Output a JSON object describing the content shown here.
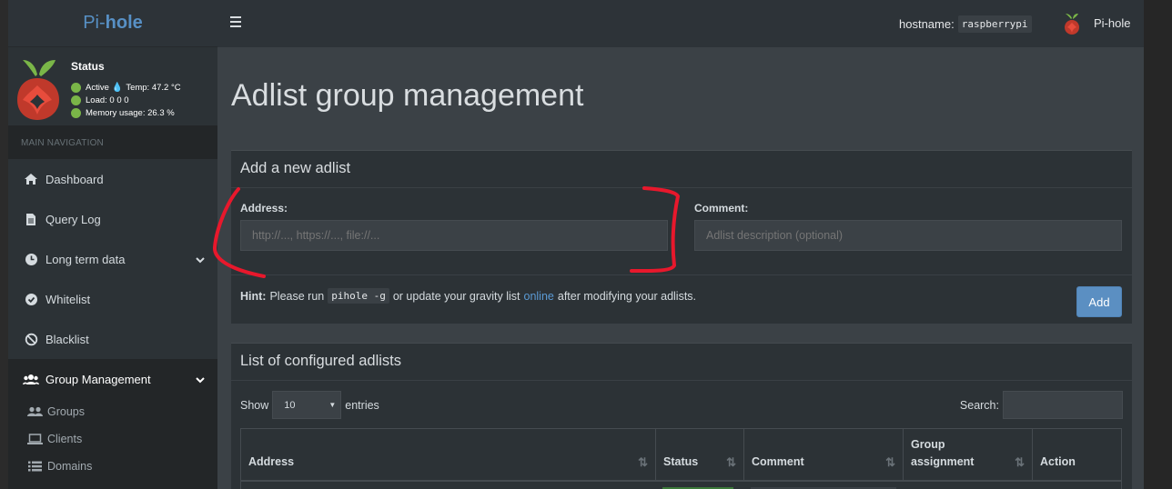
{
  "brand": {
    "prefix": "Pi-",
    "suffix": "hole"
  },
  "status": {
    "title": "Status",
    "active": "Active",
    "temp": "Temp: 47.2 °C",
    "load": "Load:  0  0  0",
    "memory": "Memory usage:  26.3 %"
  },
  "nav": {
    "header": "MAIN NAVIGATION",
    "items": [
      {
        "label": "Dashboard",
        "icon": "home-icon"
      },
      {
        "label": "Query Log",
        "icon": "file-icon"
      },
      {
        "label": "Long term data",
        "icon": "clock-icon"
      },
      {
        "label": "Whitelist",
        "icon": "check-circle-icon"
      },
      {
        "label": "Blacklist",
        "icon": "ban-icon"
      },
      {
        "label": "Group Management",
        "icon": "users-icon"
      }
    ],
    "sub_items": [
      {
        "label": "Groups",
        "icon": "user-group-icon"
      },
      {
        "label": "Clients",
        "icon": "laptop-icon"
      },
      {
        "label": "Domains",
        "icon": "list-icon"
      }
    ]
  },
  "topbar": {
    "hostname_label": "hostname:",
    "hostname_value": "raspberrypi",
    "user_name": "Pi-hole"
  },
  "page": {
    "title": "Adlist group management"
  },
  "add_box": {
    "title": "Add a new adlist",
    "address_label": "Address:",
    "address_placeholder": "http://..., https://..., file://...",
    "comment_label": "Comment:",
    "comment_placeholder": "Adlist description (optional)",
    "hint_label": "Hint:",
    "hint_text_1": "Please run",
    "hint_code": "pihole -g",
    "hint_text_2": "or update your gravity list",
    "hint_link": "online",
    "hint_text_3": "after modifying your adlists.",
    "add_label": "Add"
  },
  "list_box": {
    "title": "List of configured adlists",
    "show_label": "Show",
    "entries_value": "10",
    "entries_label": "entries",
    "search_label": "Search:",
    "columns": [
      "Address",
      "Status",
      "Comment",
      "Group assignment",
      "Action"
    ]
  },
  "colors": {
    "accent": "#5b8fc2",
    "annotation": "#e8182c",
    "status_active": "#7ab648"
  }
}
